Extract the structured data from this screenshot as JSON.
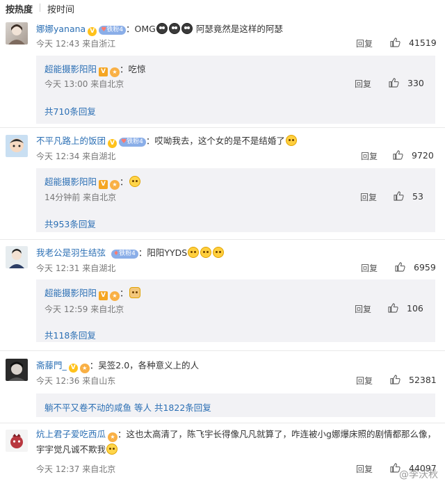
{
  "sort": {
    "hot": "按热度",
    "time": "按时间"
  },
  "labels": {
    "reply": "回复"
  },
  "comments": [
    {
      "user": "娜娜yanana",
      "badge": "铁粉4",
      "text_a": "：OMG",
      "text_b": " 阿瑟竟然是这样的阿瑟",
      "meta": "今天 12:43 来自浙江",
      "likes": "41519",
      "sub": {
        "user": "超能摄影阳阳",
        "text": "：吃惊",
        "meta": "今天 13:00 来自北京",
        "likes": "330"
      },
      "more": "共710条回复"
    },
    {
      "user": "不平凡路上的饭团",
      "badge": "铁粉4",
      "text": "：哎呦我去，这个女的是不是结婚了",
      "meta": "今天 12:34 来自湖北",
      "likes": "9720",
      "sub": {
        "user": "超能摄影阳阳",
        "text": "：",
        "meta": "14分钟前 来自北京",
        "likes": "53"
      },
      "more": "共953条回复"
    },
    {
      "user": "我老公是羽生结弦",
      "badge": "铁粉4",
      "text": "：阳阳YYDS",
      "meta": "今天 12:31 来自湖北",
      "likes": "6959",
      "sub": {
        "user": "超能摄影阳阳",
        "text": "：",
        "meta": "今天 12:59 来自北京",
        "likes": "106"
      },
      "more": "共118条回复"
    },
    {
      "user": "斋藤門_",
      "text": "：吴签2.0，各种意义上的人",
      "meta": "今天 12:36 来自山东",
      "likes": "52381",
      "sub_summary": {
        "name": "躺不平又卷不动的咸鱼",
        "rest": " 等人 共1822条回复"
      }
    },
    {
      "user": "炕上君子爱吃西瓜",
      "text": "：这也太高清了，陈飞宇长得像凡凡就算了，咋连被小g娜爆床照的剧情都那么像，宇宇觉凡诚不欺我",
      "meta": "今天 12:37 来自北京",
      "likes": "44097"
    }
  ],
  "watermark": "@李沃秋",
  "colors": {
    "username": "#eb7350",
    "link": "#2b6fb4",
    "subbox_bg": "#f2f2f5"
  }
}
